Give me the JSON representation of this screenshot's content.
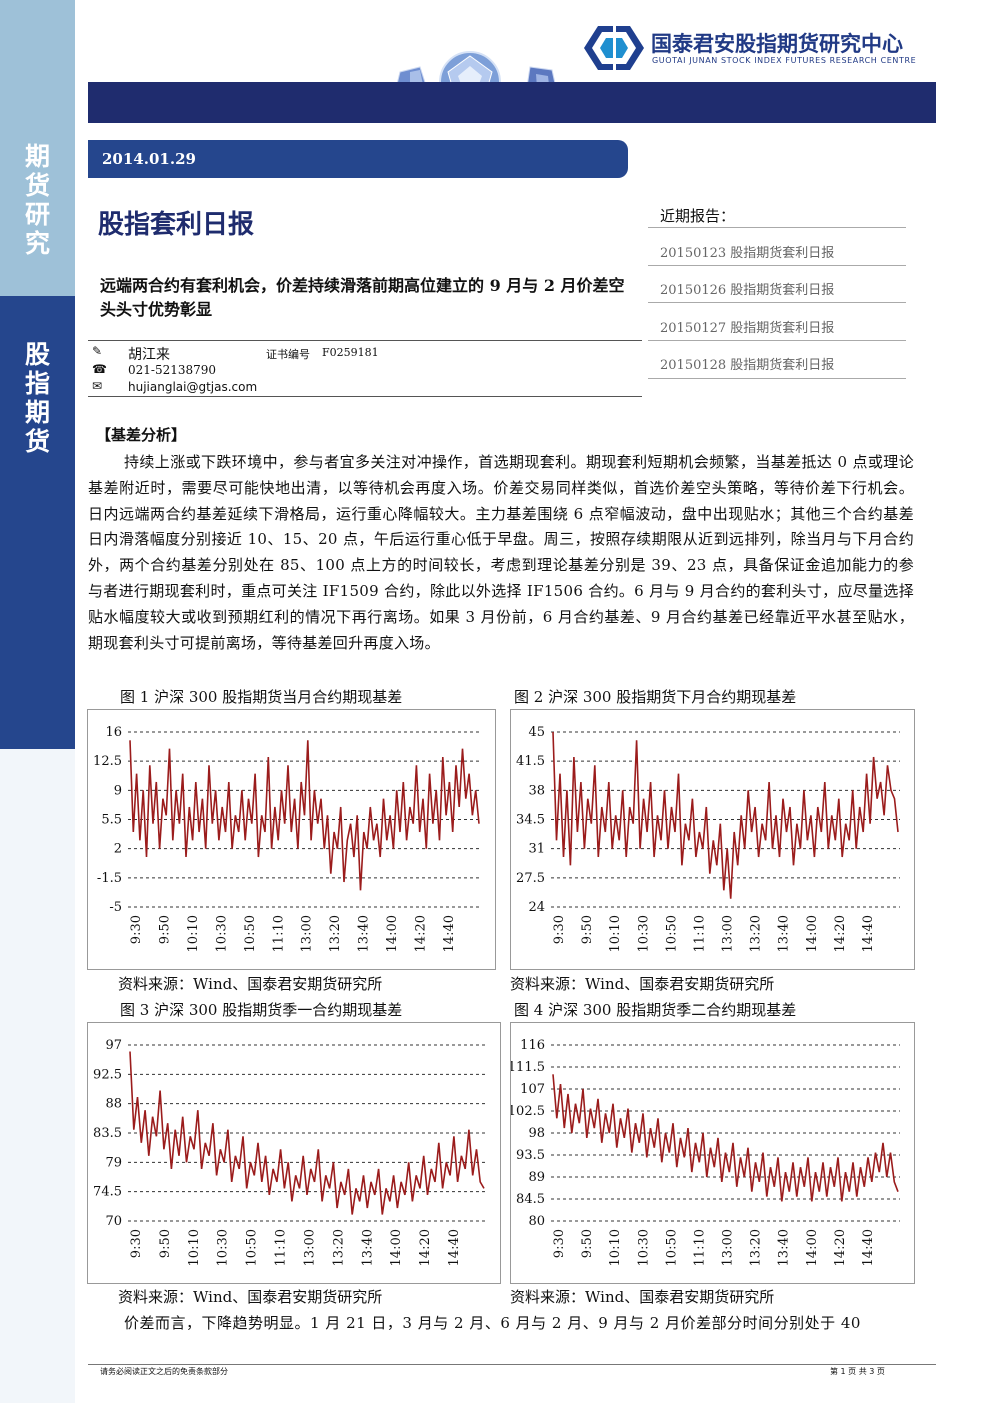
{
  "sidebar": {
    "section1": [
      "期",
      "货",
      "研",
      "究"
    ],
    "section2": [
      "股",
      "指",
      "期",
      "货"
    ]
  },
  "header": {
    "company_cn": "国泰君安股指期货研究中心",
    "company_en": "GUOTAI JUNAN STOCK INDEX FUTURES RESEARCH CENTRE",
    "logo": "guotai-junan-hexagon-logo",
    "gem_art": "diamond-gems-art"
  },
  "report": {
    "date": "2014.01.29",
    "title": "股指套利日报",
    "subtitle": "远端两合约有套利机会，价差持续滑落前期高位建立的 9 月与 2 月价差空头头寸优势彰显",
    "author": "胡江来",
    "cert_label": "证书编号",
    "cert_no": "F0259181",
    "phone": "021-52138790",
    "email": "hujianglai@gtjas.com",
    "icons": [
      "pen-icon",
      "phone-icon",
      "email-icon"
    ]
  },
  "recent": {
    "title": "近期报告：",
    "items": [
      "20150123 股指期货套利日报",
      "20150126 股指期货套利日报",
      "20150127 股指期货套利日报",
      "20150128 股指期货套利日报"
    ]
  },
  "analysis": {
    "heading": "【基差分析】",
    "body": "持续上涨或下跌环境中，参与者宜多关注对冲操作，首选期现套利。期现套利短期机会频繁，当基差抵达 0 点或理论基差附近时，需要尽可能快地出清，以等待机会再度入场。价差交易同样类似，首选价差空头策略，等待价差下行机会。日内远端两合约基差延续下滑格局，运行重心降幅较大。主力基差围绕 6 点窄幅波动，盘中出现贴水；其他三个合约基差日内滑落幅度分别接近 10、15、20 点，午后运行重心低于早盘。周三，按照存续期限从近到远排列，除当月与下月合约外，两个合约基差分别处在 85、100 点上方的时间较长，考虑到理论基差分别是 39、23 点，具备保证金追加能力的参与者进行期现套利时，重点可关注 IF1509 合约，除此以外选择 IF1506 合约。6 月与 9 月合约的套利头寸，应尽量选择贴水幅度较大或收到预期红利的情况下再行离场。如果 3 月份前，6 月合约基差、9 月合约基差已经靠近平水甚至贴水，期现套利头寸可提前离场，等待基差回升再度入场。",
    "tail": "价差而言，下降趋势明显。1 月 21 日，3 月与 2 月、6 月与 2 月、9 月与 2 月价差部分时间分别处于 40"
  },
  "figures": [
    {
      "title": "图 1 沪深 300 股指期货当月合约期现基差",
      "source": "资料来源：Wind、国泰君安期货研究所"
    },
    {
      "title": "图 2 沪深 300 股指期货下月合约期现基差",
      "source": "资料来源：Wind、国泰君安期货研究所"
    },
    {
      "title": "图 3 沪深 300 股指期货季一合约期现基差",
      "source": "资料来源：Wind、国泰君安期货研究所"
    },
    {
      "title": "图 4 沪深 300 股指期货季二合约期现基差",
      "source": "资料来源：Wind、国泰君安期货研究所"
    }
  ],
  "chart_data": [
    {
      "type": "line",
      "title": "图 1 沪深 300 股指期货当月合约期现基差",
      "x_ticks": [
        "9:30",
        "9:50",
        "10:10",
        "10:30",
        "10:50",
        "11:10",
        "13:00",
        "13:20",
        "13:40",
        "14:00",
        "14:20",
        "14:40"
      ],
      "y_ticks": [
        "16",
        "12.5",
        "9",
        "5.5",
        "2",
        "-1.5",
        "-5"
      ],
      "ylim": [
        -5,
        16
      ],
      "color": "#9b1c1c",
      "series": [
        {
          "values": [
            15,
            4,
            11,
            3,
            9,
            1,
            12,
            5,
            10,
            2,
            8,
            6,
            14,
            3,
            9,
            5,
            11,
            1,
            7,
            3,
            10,
            4,
            8,
            2,
            12,
            5,
            9,
            3,
            7,
            4,
            10,
            2,
            6,
            4,
            9,
            3,
            8,
            5,
            11,
            1,
            6,
            4,
            13,
            2,
            7,
            3,
            9,
            5,
            12,
            4,
            8,
            2,
            10,
            6,
            15,
            3,
            9,
            5,
            8,
            2,
            6,
            -1,
            4,
            2,
            7,
            -2,
            3,
            5,
            1,
            6,
            -3,
            4,
            2,
            7,
            3,
            5,
            1,
            8,
            3,
            6,
            2,
            9,
            4,
            10,
            3,
            7,
            5,
            12,
            4,
            8,
            2,
            11,
            5,
            9,
            3,
            13,
            6,
            10,
            4,
            12,
            7,
            14,
            8,
            11,
            6,
            9,
            5
          ]
        }
      ]
    },
    {
      "type": "line",
      "title": "图 2 沪深 300 股指期货下月合约期现基差",
      "x_ticks": [
        "9:30",
        "9:50",
        "10:10",
        "10:30",
        "10:50",
        "11:10",
        "13:00",
        "13:20",
        "13:40",
        "14:00",
        "14:20",
        "14:40"
      ],
      "y_ticks": [
        "45",
        "41.5",
        "38",
        "34.5",
        "31",
        "27.5",
        "24"
      ],
      "ylim": [
        24,
        45
      ],
      "color": "#9b1c1c",
      "series": [
        {
          "values": [
            45,
            32,
            40,
            30,
            38,
            29,
            42,
            33,
            39,
            31,
            37,
            34,
            41,
            30,
            36,
            33,
            39,
            31,
            35,
            32,
            38,
            30,
            36,
            34,
            44,
            31,
            37,
            33,
            39,
            30,
            35,
            32,
            38,
            31,
            36,
            33,
            40,
            29,
            34,
            32,
            37,
            30,
            33,
            31,
            36,
            28,
            32,
            29,
            34,
            26,
            31,
            25,
            33,
            29,
            35,
            31,
            38,
            33,
            36,
            30,
            34,
            32,
            39,
            31,
            35,
            30,
            37,
            33,
            36,
            29,
            34,
            31,
            38,
            32,
            35,
            30,
            36,
            33,
            39,
            31,
            35,
            32,
            37,
            30,
            34,
            32,
            38,
            31,
            36,
            33,
            40,
            34,
            42,
            37,
            39,
            35,
            41,
            38,
            37,
            33
          ]
        }
      ]
    },
    {
      "type": "line",
      "title": "图 3 沪深 300 股指期货季一合约期现基差",
      "x_ticks": [
        "9:30",
        "9:50",
        "10:10",
        "10:30",
        "10:50",
        "11:10",
        "13:00",
        "13:20",
        "13:40",
        "14:00",
        "14:20",
        "14:40"
      ],
      "y_ticks": [
        "97",
        "92.5",
        "88",
        "83.5",
        "79",
        "74.5",
        "70"
      ],
      "ylim": [
        70,
        97
      ],
      "color": "#9b1c1c",
      "series": [
        {
          "values": [
            96,
            84,
            89,
            82,
            87,
            80,
            86,
            83,
            90,
            81,
            85,
            78,
            84,
            80,
            86,
            79,
            83,
            81,
            87,
            78,
            82,
            80,
            85,
            77,
            81,
            79,
            84,
            76,
            80,
            78,
            83,
            75,
            79,
            77,
            82,
            76,
            80,
            74,
            78,
            76,
            81,
            75,
            79,
            73,
            77,
            75,
            80,
            74,
            78,
            76,
            81,
            73,
            77,
            75,
            79,
            72,
            76,
            74,
            78,
            71,
            75,
            73,
            77,
            72,
            76,
            74,
            78,
            71,
            75,
            73,
            77,
            72,
            76,
            74,
            79,
            73,
            77,
            75,
            80,
            74,
            78,
            76,
            82,
            75,
            79,
            77,
            83,
            76,
            80,
            78,
            84,
            77,
            81,
            76,
            75
          ]
        }
      ]
    },
    {
      "type": "line",
      "title": "图 4 沪深 300 股指期货季二合约期现基差",
      "x_ticks": [
        "9:30",
        "9:50",
        "10:10",
        "10:30",
        "10:50",
        "11:10",
        "13:00",
        "13:20",
        "13:40",
        "14:00",
        "14:20",
        "14:40"
      ],
      "y_ticks": [
        "116",
        "111.5",
        "107",
        "102.5",
        "98",
        "93.5",
        "89",
        "84.5",
        "80"
      ],
      "ylim": [
        80,
        116
      ],
      "color": "#9b1c1c",
      "series": [
        {
          "values": [
            110,
            101,
            108,
            99,
            106,
            98,
            104,
            100,
            107,
            97,
            103,
            99,
            105,
            96,
            102,
            98,
            104,
            95,
            101,
            97,
            103,
            94,
            100,
            96,
            102,
            93,
            99,
            95,
            101,
            92,
            98,
            94,
            100,
            91,
            97,
            93,
            99,
            90,
            96,
            92,
            98,
            89,
            95,
            91,
            97,
            88,
            94,
            90,
            96,
            87,
            93,
            89,
            95,
            86,
            92,
            88,
            94,
            85,
            91,
            87,
            93,
            84,
            90,
            86,
            92,
            85,
            91,
            87,
            93,
            84,
            90,
            86,
            92,
            85,
            91,
            87,
            93,
            84,
            90,
            86,
            92,
            85,
            91,
            87,
            93,
            88,
            94,
            90,
            96,
            89,
            94,
            88,
            86
          ]
        }
      ]
    }
  ],
  "footer": {
    "disclaimer": "请务必阅读正文之后的免责条款部分",
    "page": "第 1 页 共 3 页"
  }
}
